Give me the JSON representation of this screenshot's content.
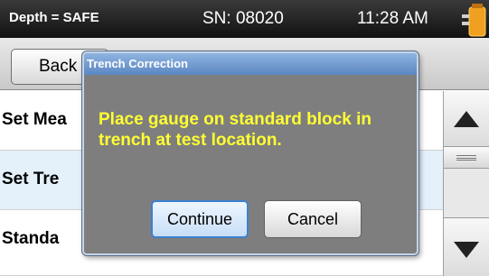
{
  "statusbar": {
    "depth": "Depth = SAFE",
    "serial": "SN: 08020",
    "time": "11:28 AM",
    "battery_icon": "battery-plug-icon"
  },
  "toolbar": {
    "back_label": "Back"
  },
  "list": {
    "items": [
      {
        "label": "Set Mea"
      },
      {
        "label": "Set Tre"
      },
      {
        "label": "Standa"
      }
    ]
  },
  "scrollbar": {
    "up_icon": "arrow-up-icon",
    "down_icon": "arrow-down-icon"
  },
  "dialog": {
    "title": "Trench Correction",
    "message": "Place gauge on standard block in trench at test location.",
    "continue_label": "Continue",
    "cancel_label": "Cancel"
  },
  "colors": {
    "message_text": "#ffff33",
    "dialog_body": "#7e7e7e",
    "title_bar": "#5b87c2",
    "selected_row": "#e4f1fb"
  }
}
